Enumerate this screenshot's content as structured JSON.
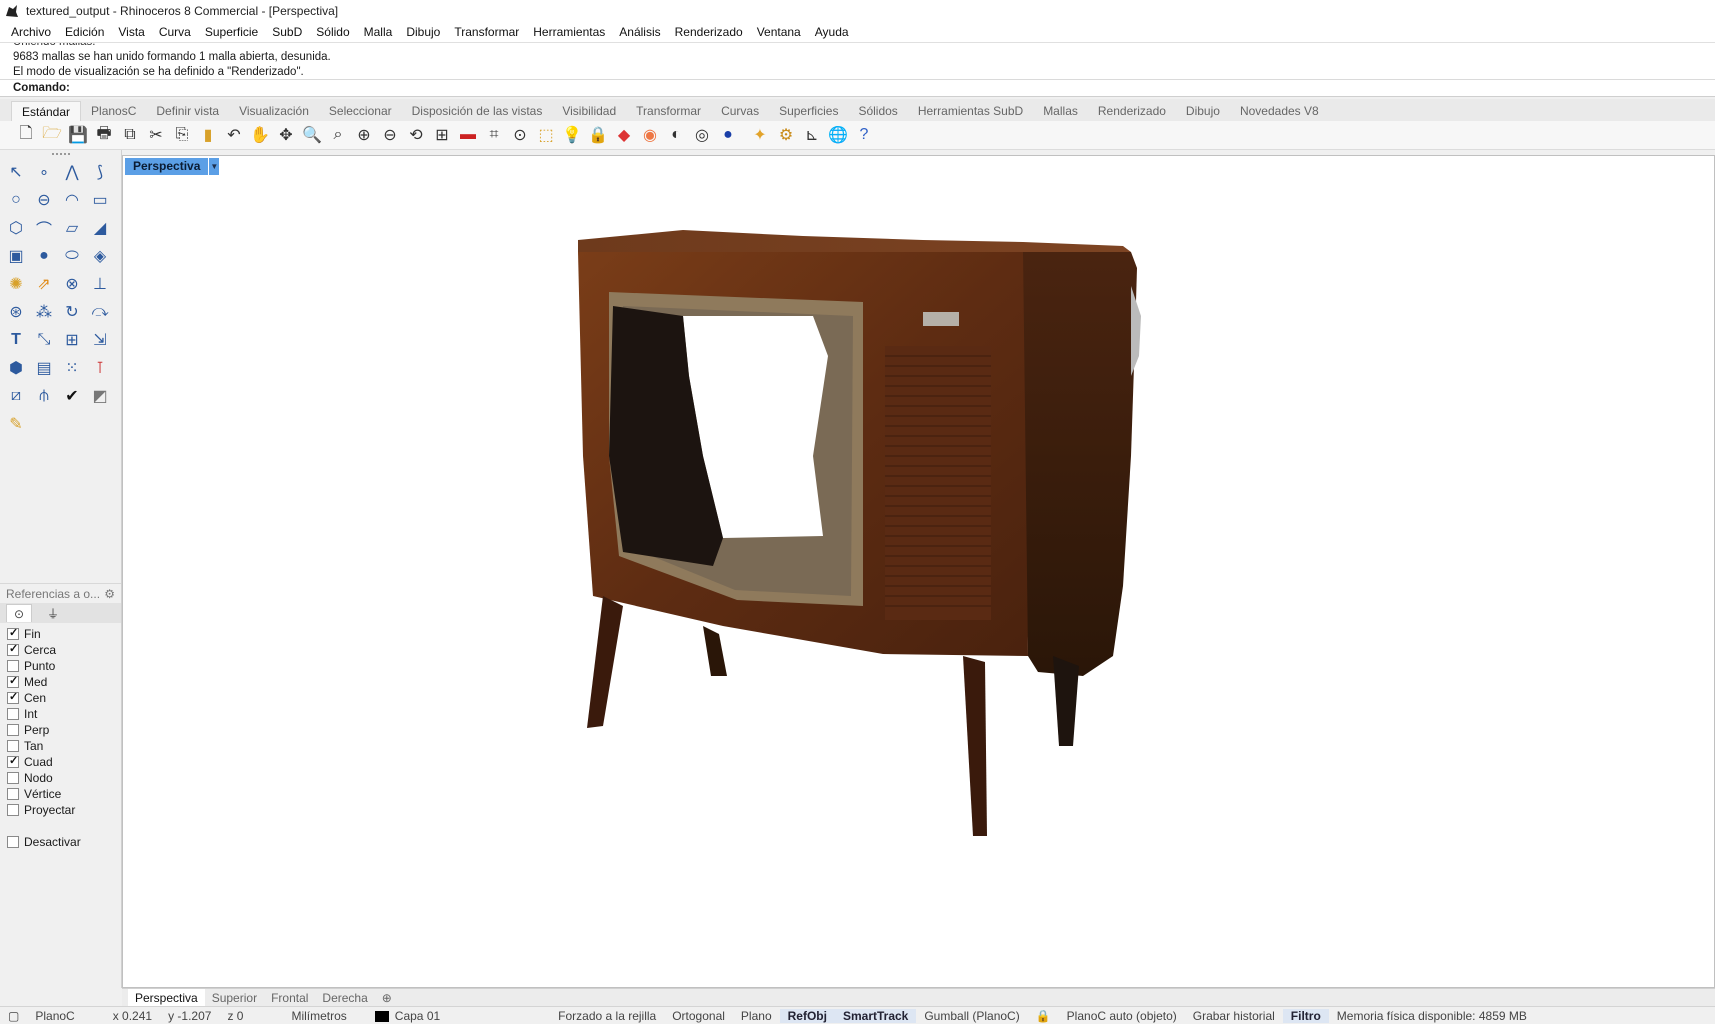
{
  "window": {
    "title": "textured_output - Rhinoceros 8 Commercial - [Perspectiva]"
  },
  "menu": [
    "Archivo",
    "Edición",
    "Vista",
    "Curva",
    "Superficie",
    "SubD",
    "Sólido",
    "Malla",
    "Dibujo",
    "Transformar",
    "Herramientas",
    "Análisis",
    "Renderizado",
    "Ventana",
    "Ayuda"
  ],
  "command": {
    "history": [
      "Uniendo mallas.",
      "9683 mallas se han unido formando 1 malla abierta, desunida.",
      "El modo de visualización se ha definido a \"Renderizado\"."
    ],
    "prompt": "Comando:",
    "value": ""
  },
  "toolbar_tabs": [
    "Estándar",
    "PlanosC",
    "Definir vista",
    "Visualización",
    "Seleccionar",
    "Disposición de las vistas",
    "Visibilidad",
    "Transformar",
    "Curvas",
    "Superficies",
    "Sólidos",
    "Herramientas SubD",
    "Mallas",
    "Renderizado",
    "Dibujo",
    "Novedades V8"
  ],
  "toolbar_tabs_active": "Estándar",
  "toolbar_icons": [
    "new-file-icon",
    "open-icon",
    "save-icon",
    "print-icon",
    "import-icon",
    "cut-icon",
    "copy-icon",
    "paste-icon",
    "undo-icon",
    "pan-icon",
    "rotate-view-icon",
    "zoom-icon",
    "zoom-window-icon",
    "zoom-extents-icon",
    "zoom-selected-icon",
    "undo-view-icon",
    "four-viewports-icon",
    "car-icon",
    "grid-icon",
    "cplane-icon",
    "select-icon",
    "light-icon",
    "lock-icon",
    "layer-icon",
    "color-wheel-icon",
    "shaded-sphere-icon",
    "wireframe-sphere-icon",
    "render-sphere-icon",
    "sun-icon",
    "gear-icon",
    "dimension-icon",
    "globe-icon",
    "help-icon"
  ],
  "left_tools": [
    "select-arrow-icon",
    "point-icon",
    "polyline-icon",
    "curve-icon",
    "circle-icon",
    "ellipse-icon",
    "arc-icon",
    "rectangle-icon",
    "polygon-icon",
    "fillet-icon",
    "surface-icon",
    "sweep-icon",
    "box-icon",
    "sphere-icon",
    "cylinder-icon",
    "mesh-icon",
    "solid-tools-icon",
    "extrude-icon",
    "boolean-icon",
    "trim-icon",
    "join-icon",
    "explode-icon",
    "rotate-icon",
    "mirror-icon",
    "text-icon",
    "scale-icon",
    "array-icon",
    "dimension-tool-icon",
    "block-icon",
    "hatch-icon",
    "grid-points-icon",
    "analyze-icon",
    "paint-icon",
    "mesh-tools-icon",
    "check-icon",
    "render-tool-icon",
    "brush-icon"
  ],
  "osnap": {
    "header": "Referencias a o...",
    "items": [
      {
        "label": "Fin",
        "checked": true
      },
      {
        "label": "Cerca",
        "checked": true
      },
      {
        "label": "Punto",
        "checked": false
      },
      {
        "label": "Med",
        "checked": true
      },
      {
        "label": "Cen",
        "checked": true
      },
      {
        "label": "Int",
        "checked": false
      },
      {
        "label": "Perp",
        "checked": false
      },
      {
        "label": "Tan",
        "checked": false
      },
      {
        "label": "Cuad",
        "checked": true
      },
      {
        "label": "Nodo",
        "checked": false
      },
      {
        "label": "Vértice",
        "checked": false
      },
      {
        "label": "Proyectar",
        "checked": false
      }
    ],
    "disable": {
      "label": "Desactivar",
      "checked": false
    }
  },
  "viewport": {
    "name": "Perspectiva"
  },
  "view_tabs": [
    "Perspectiva",
    "Superior",
    "Frontal",
    "Derecha"
  ],
  "status": {
    "cplane": "PlanoC",
    "x": "x 0.241",
    "y": "y -1.207",
    "z": "z 0",
    "units": "Milímetros",
    "layer": "Capa 01",
    "grid_snap": "Forzado a la rejilla",
    "ortho": "Ortogonal",
    "planar": "Plano",
    "osnap": "RefObj",
    "smarttrack": "SmartTrack",
    "gumball": "Gumball (PlanoC)",
    "auto_cplane": "PlanoC auto (objeto)",
    "history": "Grabar historial",
    "filter": "Filtro",
    "memory": "Memoria física disponible: 4859 MB"
  },
  "colors": {
    "active_tab": "#5b9fe6",
    "wood": "#6b3417"
  }
}
